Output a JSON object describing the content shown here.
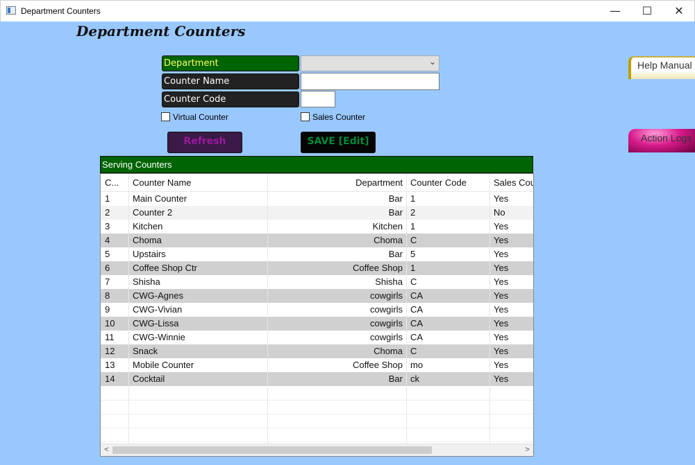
{
  "window": {
    "title": "Department Counters",
    "controls": {
      "minimize": "—",
      "maximize": "☐",
      "close": "✕"
    }
  },
  "page": {
    "title": "Department Counters"
  },
  "form": {
    "department_label": "Department",
    "department_value": "",
    "counter_name_label": "Counter Name",
    "counter_name_value": "",
    "counter_code_label": "Counter Code",
    "counter_code_value": "",
    "virtual_counter_label": "Virtual Counter",
    "sales_counter_label": "Sales Counter"
  },
  "buttons": {
    "refresh": "Refresh",
    "save": "SAVE [Edit]",
    "help": "Help Manual",
    "action_logs": "Action Logs"
  },
  "grid": {
    "title": "Serving Counters",
    "columns": [
      "C...",
      "Counter Name",
      "Department",
      "Counter Code",
      "Sales Counter"
    ],
    "rows": [
      {
        "code": "1",
        "name": "Main Counter",
        "dept": "Bar",
        "ccode": "1",
        "sales": "Yes"
      },
      {
        "code": "2",
        "name": "Counter 2",
        "dept": "Bar",
        "ccode": "2",
        "sales": "No"
      },
      {
        "code": "3",
        "name": "Kitchen",
        "dept": "Kitchen",
        "ccode": "1",
        "sales": "Yes"
      },
      {
        "code": "4",
        "name": "Choma",
        "dept": "Choma",
        "ccode": "C",
        "sales": "Yes"
      },
      {
        "code": "5",
        "name": "Upstairs",
        "dept": "Bar",
        "ccode": "5",
        "sales": "Yes"
      },
      {
        "code": "6",
        "name": "Coffee Shop Ctr",
        "dept": "Coffee Shop",
        "ccode": "1",
        "sales": "Yes"
      },
      {
        "code": "7",
        "name": "Shisha",
        "dept": "Shisha",
        "ccode": "C",
        "sales": "Yes"
      },
      {
        "code": "8",
        "name": "CWG-Agnes",
        "dept": "cowgirls",
        "ccode": "CA",
        "sales": "Yes"
      },
      {
        "code": "9",
        "name": "CWG-Vivian",
        "dept": "cowgirls",
        "ccode": "CA",
        "sales": "Yes"
      },
      {
        "code": "10",
        "name": "CWG-Lissa",
        "dept": "cowgirls",
        "ccode": "CA",
        "sales": "Yes"
      },
      {
        "code": "11",
        "name": "CWG-Winnie",
        "dept": "cowgirls",
        "ccode": "CA",
        "sales": "Yes"
      },
      {
        "code": "12",
        "name": "Snack",
        "dept": "Choma",
        "ccode": "C",
        "sales": "Yes"
      },
      {
        "code": "13",
        "name": "Mobile Counter",
        "dept": "Coffee Shop",
        "ccode": "mo",
        "sales": "Yes"
      },
      {
        "code": "14",
        "name": "Cocktail",
        "dept": "Bar",
        "ccode": "ck",
        "sales": "Yes"
      }
    ],
    "scroll_left": "<",
    "scroll_right": ">"
  }
}
